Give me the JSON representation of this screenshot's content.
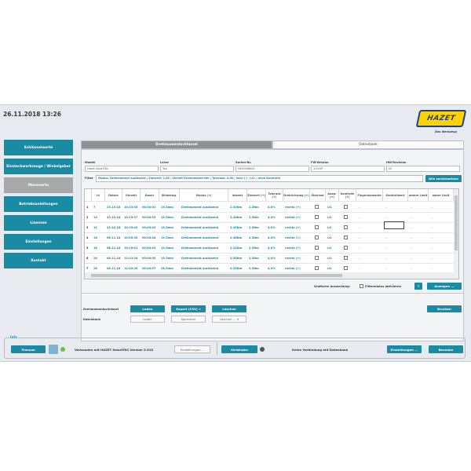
{
  "header": {
    "datetime": "26.11.2018 13:26",
    "logo_text": "HAZET",
    "slogan": "Das Werkzeug"
  },
  "sidebar": {
    "items": [
      {
        "label": "Schlüsselwerte",
        "active": false
      },
      {
        "label": "Einsteckwerkzeuge / Winkelgeber",
        "active": false
      },
      {
        "label": "Messwerte",
        "active": true
      },
      {
        "label": "Betriebsanleitungen",
        "active": false
      },
      {
        "label": "Lizenzen",
        "active": false
      },
      {
        "label": "Einstellungen",
        "active": false
      },
      {
        "label": "Kontakt",
        "active": false
      }
    ]
  },
  "tabs": [
    {
      "label": "Drehmomentschlüssel",
      "active": true
    },
    {
      "label": "Datenbank",
      "active": false
    }
  ],
  "device": {
    "modell_label": "Modell",
    "modell_value": "Hazet SmartTAC",
    "level_label": "Level",
    "level_value": "Top",
    "serie_label": "Serien-Nr.",
    "serie_value": "9455948002",
    "fw_label": "FW-Version",
    "fw_value": "3.01SP",
    "hw_label": "HW-Revision",
    "hw_value": "02"
  },
  "filter": {
    "label": "Filter",
    "value": "Modus: Drehmoment auslösend | Zielwert: 2,50 | Einheit Drehmoment Nm | Toleranz: 4,00 | links (-) | LO. | ohne Kontrolle",
    "reset_button": "Alle zurücksetzen"
  },
  "table": {
    "columns": [
      "",
      "Id",
      "Datum",
      "Uhrzeit",
      "Dauer",
      "Winkelwg.",
      "Modus (+)",
      "Istwert",
      "Zielwert (+)",
      "Toleranz (+)",
      "Drehrichtung (+)",
      "Überlast",
      "Ausw. (+)",
      "Kontrolle (+)",
      "Fingermomente",
      "Kontrollwert",
      "untere Limit",
      "obere Limit"
    ],
    "rows": [
      [
        "1",
        "7",
        "23.10.18",
        "10:15:05",
        "00:00:03",
        "19,5mm",
        "Drehmoment auslösend",
        "2,52Nm",
        "2,5Nm",
        "4,0%",
        "rechts (+)",
        "",
        "LO.",
        "",
        "---",
        "---",
        "---",
        "---"
      ],
      [
        "2",
        "10",
        "23.10.18",
        "10:15:37",
        "00:00:03",
        "19,5mm",
        "Drehmoment auslösend",
        "2,44Nm",
        "2,5Nm",
        "4,0%",
        "rechts (+)",
        "",
        "LO.",
        "",
        "---",
        "---",
        "---",
        "---"
      ],
      [
        "3",
        "11",
        "23.10.18",
        "10:15:49",
        "00:00:03",
        "19,5mm",
        "Drehmoment auslösend",
        "2,45Nm",
        "2,5Nm",
        "4,0%",
        "rechts (+)",
        "",
        "LO.",
        "",
        "---",
        "---",
        "---",
        "---"
      ],
      [
        "4",
        "16",
        "06.11.18",
        "10:09:30",
        "00:00:04",
        "19,5mm",
        "Drehmoment auslösend",
        "2,48Nm",
        "2,5Nm",
        "4,0%",
        "rechts (+)",
        "",
        "LO.",
        "",
        "---",
        "---",
        "---",
        "---"
      ],
      [
        "5",
        "18",
        "06.11.18",
        "10:10:01",
        "00:00:04",
        "19,5mm",
        "Drehmoment auslösend",
        "2,41Nm",
        "2,5Nm",
        "4,0%",
        "rechts (+)",
        "",
        "LO.",
        "",
        "---",
        "---",
        "---",
        "---"
      ],
      [
        "6",
        "24",
        "08.11.18",
        "12:13:34",
        "00:00:05",
        "19,5mm",
        "Drehmoment auslösend",
        "2,55Nm",
        "2,5Nm",
        "4,0%",
        "rechts (+)",
        "",
        "LO.",
        "",
        "---",
        "---",
        "---",
        "---"
      ],
      [
        "7",
        "28",
        "08.11.18",
        "12:19:35",
        "00:00:07",
        "38,5mm",
        "Drehmoment auslösend",
        "2,55Nm",
        "2,5Nm",
        "4,0%",
        "rechts (+)",
        "",
        "LO.",
        "",
        "---",
        "---",
        "---",
        "---"
      ]
    ]
  },
  "graph": {
    "label": "Grafische Auswertung:",
    "filtermode_label": "Filtermodus aktivieren",
    "info_button": "?",
    "show_button": "Anzeigen ..."
  },
  "actions": {
    "dm_label": "Drehmomentschlüssel",
    "db_label": "Datenbank",
    "laden": "Laden",
    "export": "Export (CSV)",
    "loeschen": "Löschen",
    "speichern": "Speichern",
    "loeschen_dd": "Löschen ...",
    "drucken": "Drucken"
  },
  "info": {
    "title": "Info",
    "trennen": "Trennen",
    "connected_text": "Verbunden mit HAZET SmartTAC Version 3.01S",
    "einst1": "Einstellungen ...",
    "verbinden": "Verbinden",
    "db_text": "Keine Verbindung mit Datenbank",
    "einst2": "Einstellungen ...",
    "beenden": "Beenden"
  },
  "colors": {
    "accent": "#1b8aa3",
    "connected": "#6cc04a",
    "disconnected": "#555555",
    "logo_yellow": "#ffd200",
    "logo_blue": "#1c3f8c"
  }
}
